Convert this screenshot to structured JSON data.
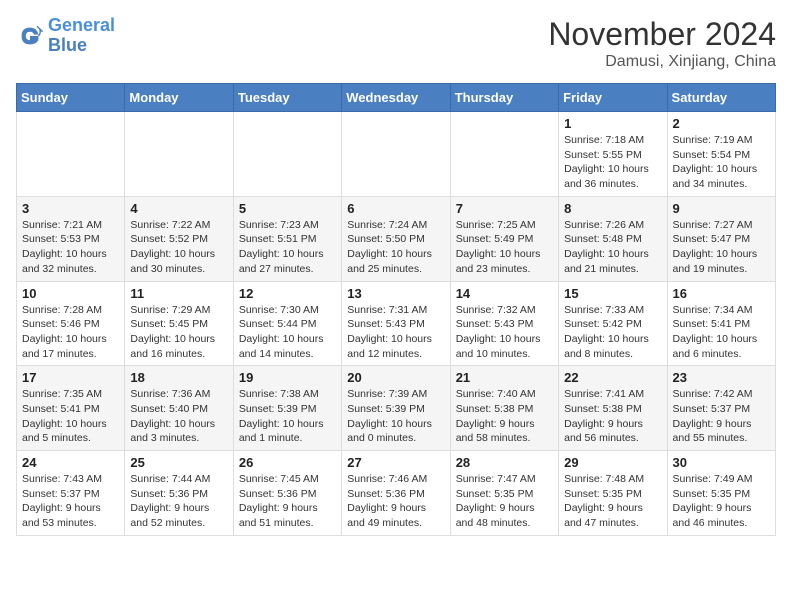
{
  "header": {
    "logo_line1": "General",
    "logo_line2": "Blue",
    "month": "November 2024",
    "location": "Damusi, Xinjiang, China"
  },
  "weekdays": [
    "Sunday",
    "Monday",
    "Tuesday",
    "Wednesday",
    "Thursday",
    "Friday",
    "Saturday"
  ],
  "weeks": [
    [
      {
        "day": "",
        "info": ""
      },
      {
        "day": "",
        "info": ""
      },
      {
        "day": "",
        "info": ""
      },
      {
        "day": "",
        "info": ""
      },
      {
        "day": "",
        "info": ""
      },
      {
        "day": "1",
        "info": "Sunrise: 7:18 AM\nSunset: 5:55 PM\nDaylight: 10 hours and 36 minutes."
      },
      {
        "day": "2",
        "info": "Sunrise: 7:19 AM\nSunset: 5:54 PM\nDaylight: 10 hours and 34 minutes."
      }
    ],
    [
      {
        "day": "3",
        "info": "Sunrise: 7:21 AM\nSunset: 5:53 PM\nDaylight: 10 hours and 32 minutes."
      },
      {
        "day": "4",
        "info": "Sunrise: 7:22 AM\nSunset: 5:52 PM\nDaylight: 10 hours and 30 minutes."
      },
      {
        "day": "5",
        "info": "Sunrise: 7:23 AM\nSunset: 5:51 PM\nDaylight: 10 hours and 27 minutes."
      },
      {
        "day": "6",
        "info": "Sunrise: 7:24 AM\nSunset: 5:50 PM\nDaylight: 10 hours and 25 minutes."
      },
      {
        "day": "7",
        "info": "Sunrise: 7:25 AM\nSunset: 5:49 PM\nDaylight: 10 hours and 23 minutes."
      },
      {
        "day": "8",
        "info": "Sunrise: 7:26 AM\nSunset: 5:48 PM\nDaylight: 10 hours and 21 minutes."
      },
      {
        "day": "9",
        "info": "Sunrise: 7:27 AM\nSunset: 5:47 PM\nDaylight: 10 hours and 19 minutes."
      }
    ],
    [
      {
        "day": "10",
        "info": "Sunrise: 7:28 AM\nSunset: 5:46 PM\nDaylight: 10 hours and 17 minutes."
      },
      {
        "day": "11",
        "info": "Sunrise: 7:29 AM\nSunset: 5:45 PM\nDaylight: 10 hours and 16 minutes."
      },
      {
        "day": "12",
        "info": "Sunrise: 7:30 AM\nSunset: 5:44 PM\nDaylight: 10 hours and 14 minutes."
      },
      {
        "day": "13",
        "info": "Sunrise: 7:31 AM\nSunset: 5:43 PM\nDaylight: 10 hours and 12 minutes."
      },
      {
        "day": "14",
        "info": "Sunrise: 7:32 AM\nSunset: 5:43 PM\nDaylight: 10 hours and 10 minutes."
      },
      {
        "day": "15",
        "info": "Sunrise: 7:33 AM\nSunset: 5:42 PM\nDaylight: 10 hours and 8 minutes."
      },
      {
        "day": "16",
        "info": "Sunrise: 7:34 AM\nSunset: 5:41 PM\nDaylight: 10 hours and 6 minutes."
      }
    ],
    [
      {
        "day": "17",
        "info": "Sunrise: 7:35 AM\nSunset: 5:41 PM\nDaylight: 10 hours and 5 minutes."
      },
      {
        "day": "18",
        "info": "Sunrise: 7:36 AM\nSunset: 5:40 PM\nDaylight: 10 hours and 3 minutes."
      },
      {
        "day": "19",
        "info": "Sunrise: 7:38 AM\nSunset: 5:39 PM\nDaylight: 10 hours and 1 minute."
      },
      {
        "day": "20",
        "info": "Sunrise: 7:39 AM\nSunset: 5:39 PM\nDaylight: 10 hours and 0 minutes."
      },
      {
        "day": "21",
        "info": "Sunrise: 7:40 AM\nSunset: 5:38 PM\nDaylight: 9 hours and 58 minutes."
      },
      {
        "day": "22",
        "info": "Sunrise: 7:41 AM\nSunset: 5:38 PM\nDaylight: 9 hours and 56 minutes."
      },
      {
        "day": "23",
        "info": "Sunrise: 7:42 AM\nSunset: 5:37 PM\nDaylight: 9 hours and 55 minutes."
      }
    ],
    [
      {
        "day": "24",
        "info": "Sunrise: 7:43 AM\nSunset: 5:37 PM\nDaylight: 9 hours and 53 minutes."
      },
      {
        "day": "25",
        "info": "Sunrise: 7:44 AM\nSunset: 5:36 PM\nDaylight: 9 hours and 52 minutes."
      },
      {
        "day": "26",
        "info": "Sunrise: 7:45 AM\nSunset: 5:36 PM\nDaylight: 9 hours and 51 minutes."
      },
      {
        "day": "27",
        "info": "Sunrise: 7:46 AM\nSunset: 5:36 PM\nDaylight: 9 hours and 49 minutes."
      },
      {
        "day": "28",
        "info": "Sunrise: 7:47 AM\nSunset: 5:35 PM\nDaylight: 9 hours and 48 minutes."
      },
      {
        "day": "29",
        "info": "Sunrise: 7:48 AM\nSunset: 5:35 PM\nDaylight: 9 hours and 47 minutes."
      },
      {
        "day": "30",
        "info": "Sunrise: 7:49 AM\nSunset: 5:35 PM\nDaylight: 9 hours and 46 minutes."
      }
    ]
  ]
}
